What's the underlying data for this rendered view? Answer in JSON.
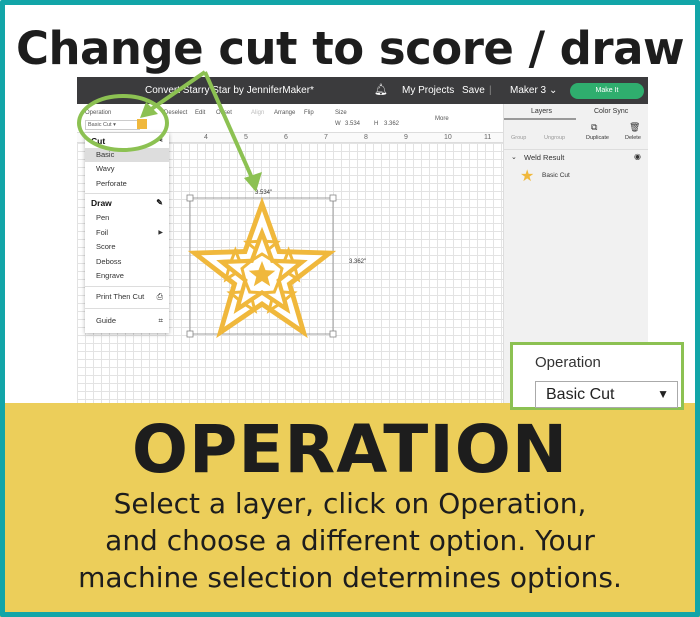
{
  "headline": "Change cut to score / draw",
  "app": {
    "title": "Convert Starry Star by JenniferMaker*",
    "nav": {
      "my_projects": "My Projects",
      "save": "Save",
      "machine": "Maker 3",
      "make_it": "Make It"
    },
    "toolbar": {
      "operation_label": "Operation",
      "operation_value": "Basic Cut",
      "deselect": "Deselect",
      "edit": "Edit",
      "offset": "Offset",
      "align": "Align",
      "arrange": "Arrange",
      "flip": "Flip",
      "size": "Size",
      "w_label": "W",
      "w_value": "3.534",
      "h_label": "H",
      "h_value": "3.362",
      "more": "More"
    },
    "swatch_color": "#f0b83c",
    "ruler": [
      "4",
      "5",
      "6",
      "7",
      "8",
      "9",
      "10",
      "11"
    ],
    "dimensions": {
      "width": "3.534\"",
      "height": "3.362\""
    },
    "panel": {
      "tabs": [
        "Layers",
        "Color Sync"
      ],
      "actions": [
        "Group",
        "Ungroup",
        "Duplicate",
        "Delete"
      ],
      "group": "Weld Result",
      "layer": "Basic Cut"
    },
    "menu": {
      "cut_header": "Cut",
      "cut_items": [
        "Basic",
        "Wavy",
        "Perforate"
      ],
      "draw_header": "Draw",
      "draw_items": [
        "Pen",
        "Foil",
        "Score",
        "Deboss",
        "Engrave"
      ],
      "print_then_cut": "Print Then Cut",
      "guide": "Guide"
    }
  },
  "callout": {
    "label": "Operation",
    "value": "Basic Cut"
  },
  "banner": {
    "title": "OPERATION",
    "lines": [
      "Select a layer, click on Operation,",
      "and choose a different option. Your",
      "machine selection determines options."
    ]
  },
  "colors": {
    "border": "#12a5a8",
    "banner": "#ecce5a",
    "accent_green": "#8cc152",
    "make_it": "#2fae6e",
    "star": "#f0b83c"
  }
}
